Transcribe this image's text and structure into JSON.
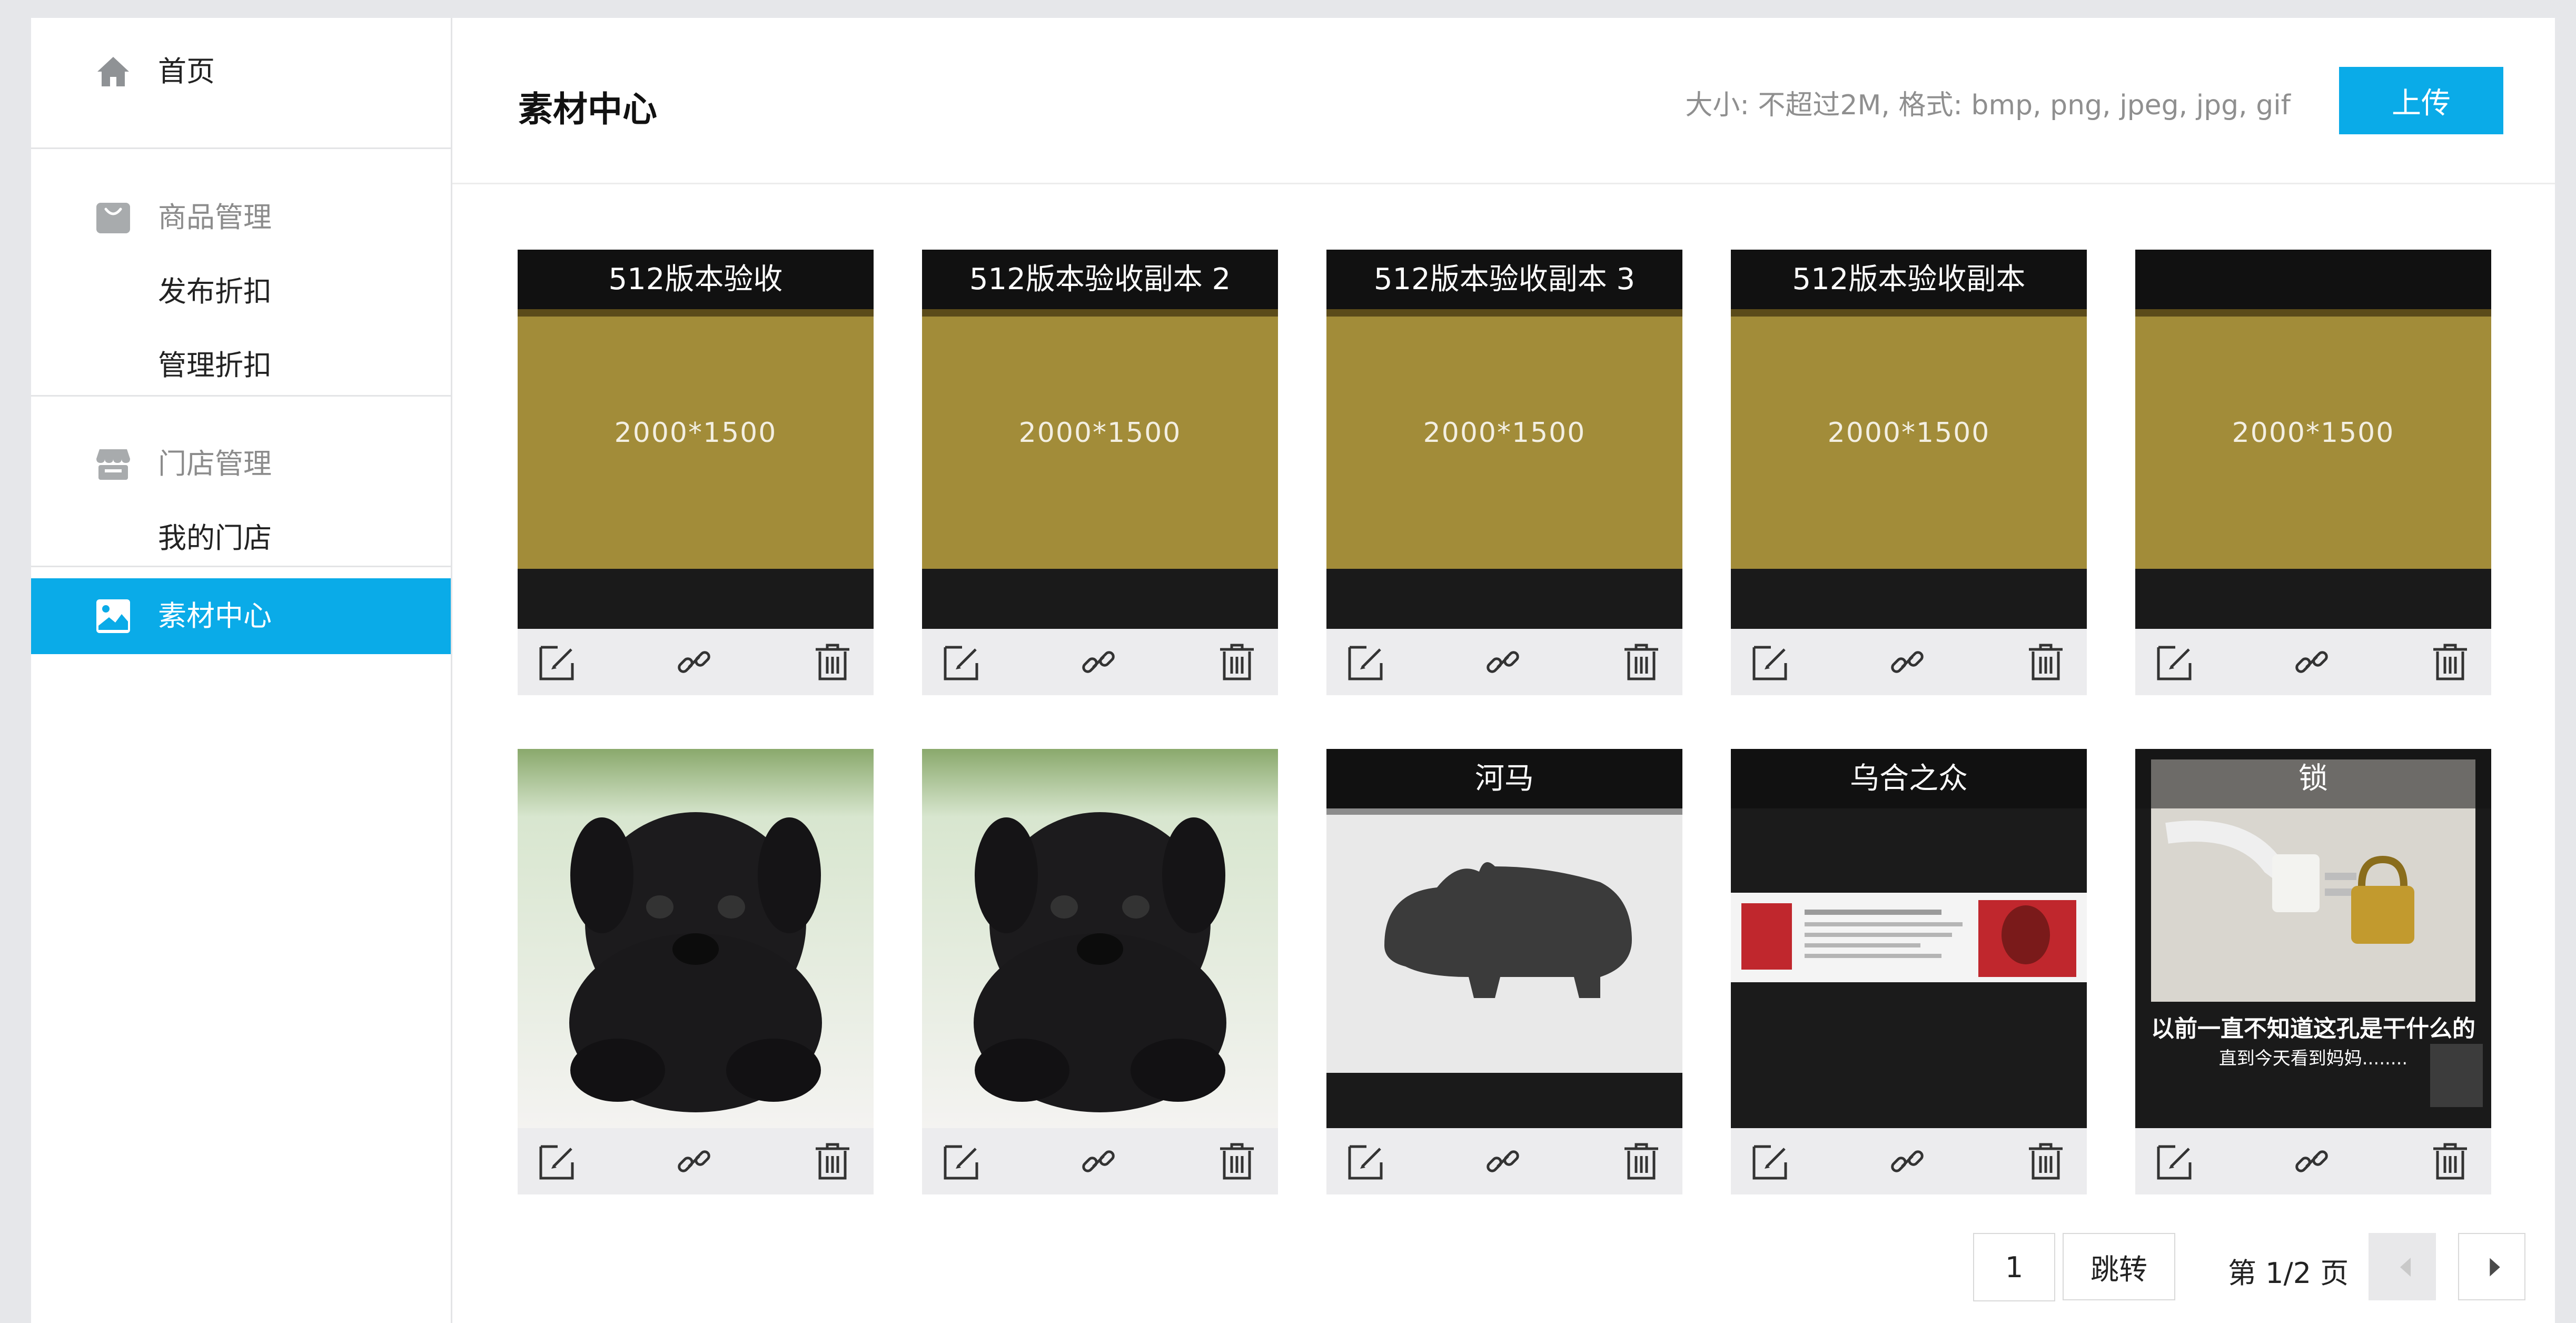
{
  "sidebar": {
    "home": {
      "label": "首页",
      "icon": "home-icon"
    },
    "goods_group": {
      "label": "商品管理",
      "icon": "shopping-bag-icon"
    },
    "publish_discount": {
      "label": "发布折扣"
    },
    "manage_discount": {
      "label": "管理折扣"
    },
    "store_group": {
      "label": "门店管理",
      "icon": "store-icon"
    },
    "my_store": {
      "label": "我的门店"
    },
    "material_center": {
      "label": "素材中心",
      "icon": "image-icon"
    }
  },
  "header": {
    "title": "素材中心",
    "upload_hint": "大小: 不超过2M, 格式: bmp, png, jpeg, jpg, gif",
    "upload_label": "上传"
  },
  "materials": [
    {
      "name": "512版本验收",
      "size_text": "2000*1500",
      "kind": "gold-placeholder"
    },
    {
      "name": "512版本验收副本 2",
      "size_text": "2000*1500",
      "kind": "gold-placeholder"
    },
    {
      "name": "512版本验收副本 3",
      "size_text": "2000*1500",
      "kind": "gold-placeholder"
    },
    {
      "name": "512版本验收副本",
      "size_text": "2000*1500",
      "kind": "gold-placeholder"
    },
    {
      "name": "",
      "size_text": "2000*1500",
      "kind": "gold-placeholder"
    },
    {
      "name": "",
      "kind": "pug-photo"
    },
    {
      "name": "",
      "kind": "pug-photo"
    },
    {
      "name": "河马",
      "kind": "hippo-image"
    },
    {
      "name": "乌合之众",
      "kind": "business-card"
    },
    {
      "name": "锁",
      "kind": "lock-meme",
      "caption_line1": "以前一直不知道这孔是干什么的",
      "caption_line2": "直到今天看到妈妈........"
    }
  ],
  "pagination": {
    "current_page": "1",
    "jump_label": "跳转",
    "page_info": "第 1/2 页"
  },
  "colors": {
    "accent": "#0aabe8",
    "gold": "#a28c39",
    "dark": "#111111"
  }
}
